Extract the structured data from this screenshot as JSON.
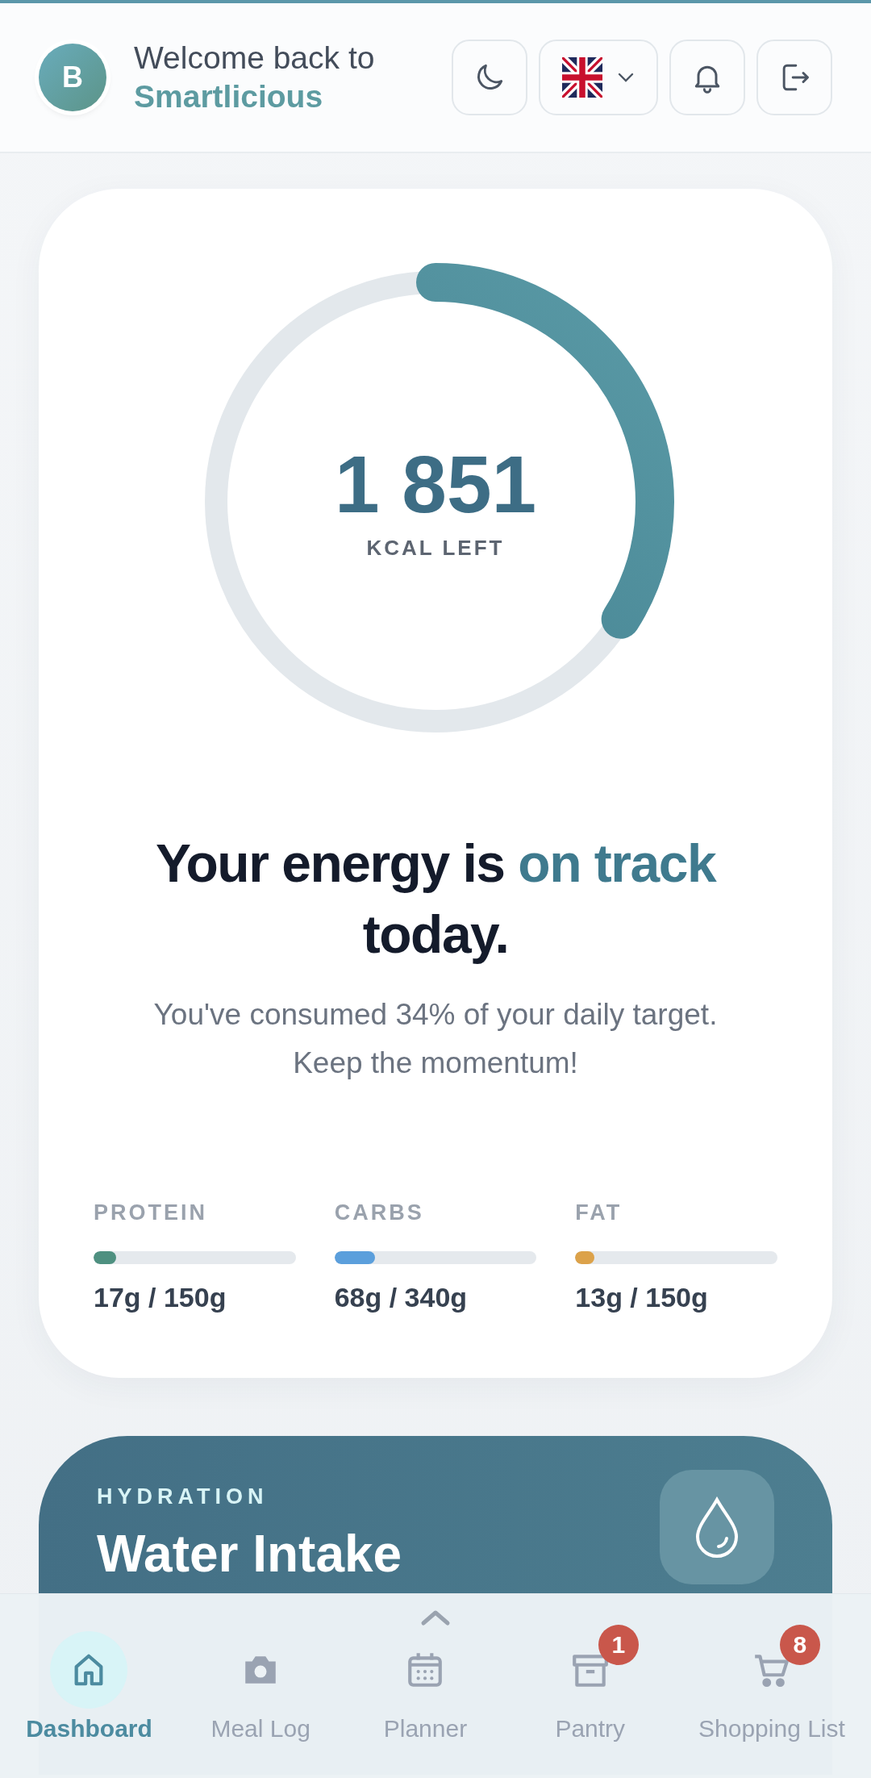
{
  "header": {
    "avatar_letter": "B",
    "greeting": "Welcome back to",
    "app_name": "Smartlicious"
  },
  "calories": {
    "value": "1 851",
    "label": "KCAL LEFT",
    "level": 0.34
  },
  "status": {
    "before": "Your energy is",
    "highlight": "on track",
    "after": "today.",
    "message": "You've consumed 34% of your daily target. Keep the momentum!"
  },
  "macros": [
    {
      "name": "PROTEIN",
      "amount": "17g / 150g",
      "level": 0.113,
      "color": "#4e9080"
    },
    {
      "name": "CARBS",
      "amount": "68g / 340g",
      "level": 0.2,
      "color": "#5b9fdc"
    },
    {
      "name": "FAT",
      "amount": "13g / 150g",
      "level": 0.087,
      "color": "#dca24a"
    }
  ],
  "hydration": {
    "eyebrow": "HYDRATION",
    "title": "Water Intake"
  },
  "nav": [
    {
      "label": "Dashboard",
      "selected": true,
      "kind": "home"
    },
    {
      "label": "Meal Log",
      "selected": false,
      "kind": "camera"
    },
    {
      "label": "Planner",
      "selected": false,
      "kind": "calendar"
    },
    {
      "label": "Pantry",
      "selected": false,
      "kind": "box",
      "badge": "1"
    },
    {
      "label": "Shopping List",
      "selected": false,
      "kind": "cart",
      "badge": "8"
    }
  ]
}
